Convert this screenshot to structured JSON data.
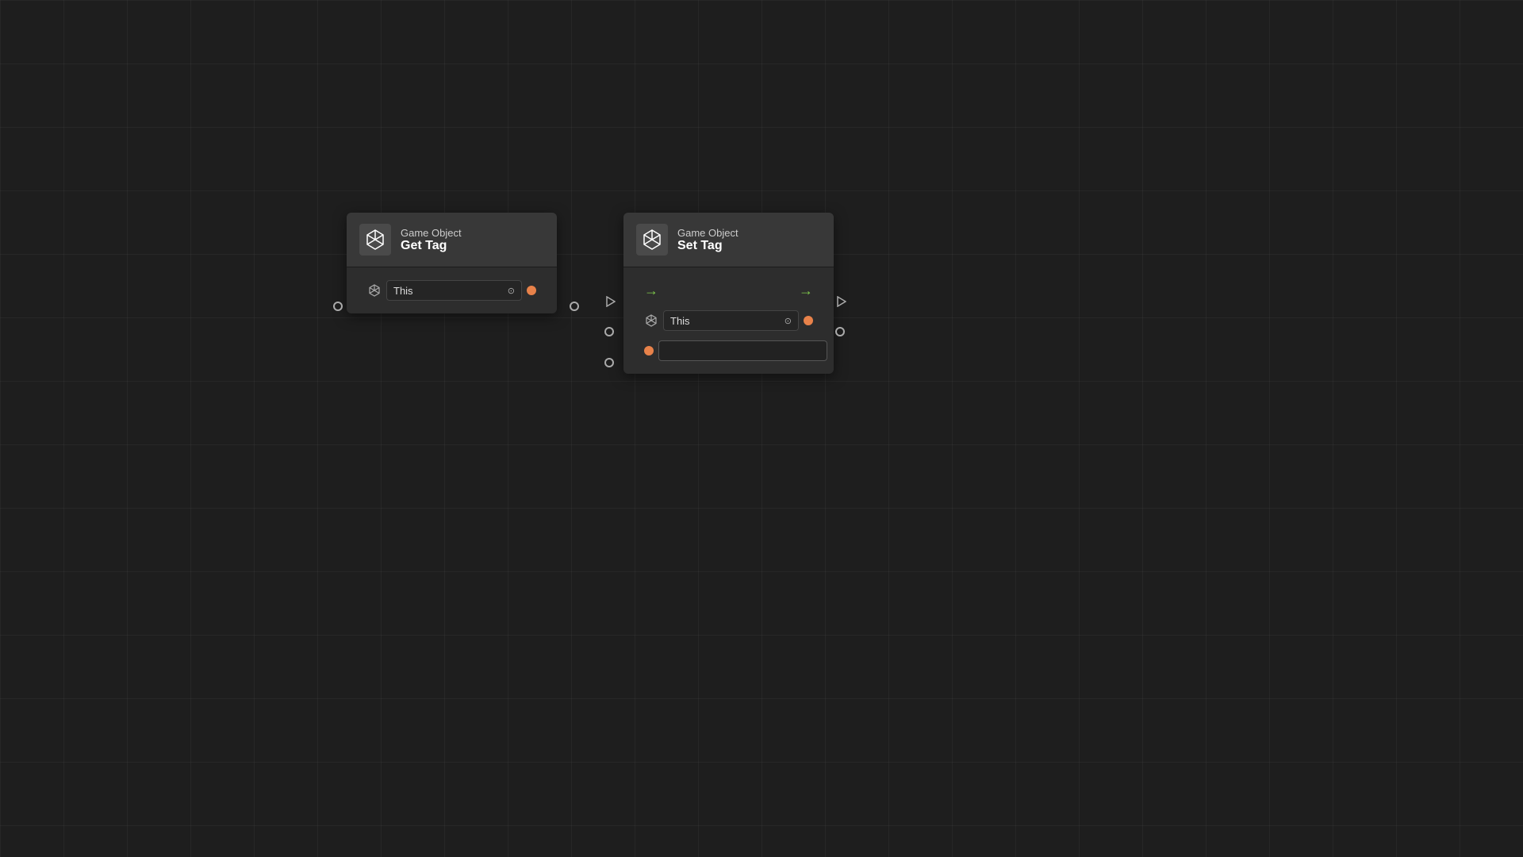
{
  "canvas": {
    "background_color": "#1e1e1e",
    "grid_color": "rgba(255,255,255,0.04)"
  },
  "nodes": {
    "get_tag": {
      "title_top": "Game Object",
      "title_bottom": "Get Tag",
      "input_label": "This",
      "input_placeholder": "This"
    },
    "set_tag": {
      "title_top": "Game Object",
      "title_bottom": "Set Tag",
      "input_label": "This",
      "input_placeholder": "This",
      "tag_input_value": ""
    }
  },
  "colors": {
    "orange_port": "#e8824a",
    "green_arrow": "#7ec94c",
    "node_bg": "#2d2d2d",
    "node_header_bg": "#383838",
    "empty_port_border": "#888888"
  }
}
